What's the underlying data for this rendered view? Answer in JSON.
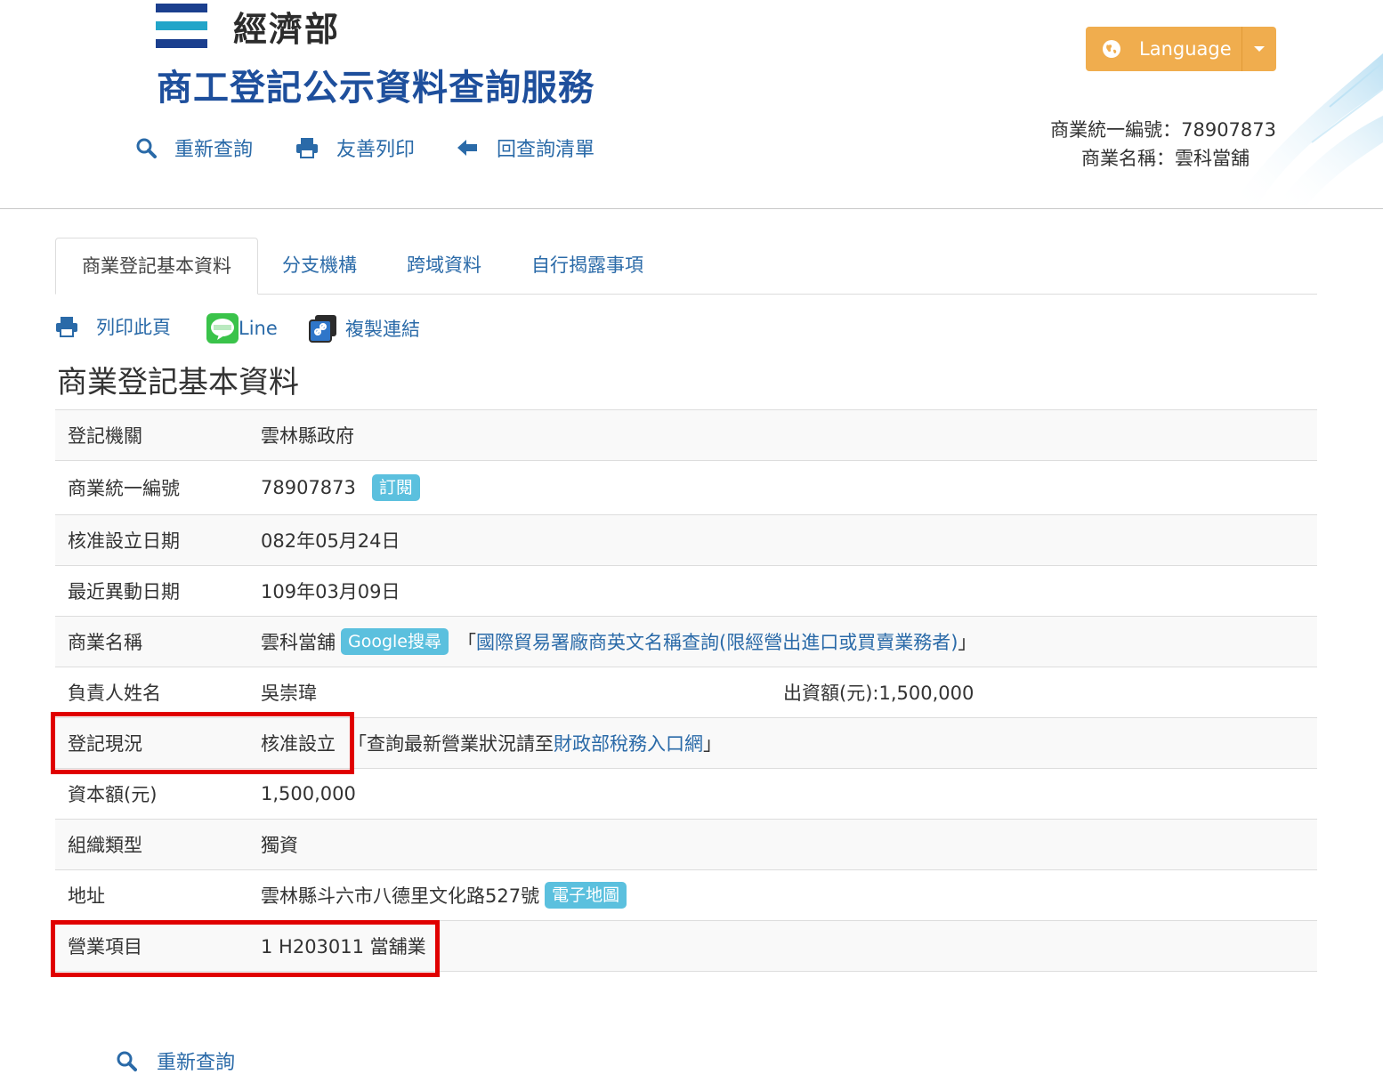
{
  "header": {
    "ministry": "經濟部",
    "service_title": "商工登記公示資料查詢服務",
    "language_button": "Language",
    "links": {
      "requery": "重新查詢",
      "print_friendly": "友善列印",
      "back_to_list": "回查詢清單"
    },
    "biz_id_line": "商業統一編號：78907873",
    "biz_name_line": "商業名稱：雲科當舖"
  },
  "tabs": [
    "商業登記基本資料",
    "分支機構",
    "跨域資料",
    "自行揭露事項"
  ],
  "actions": {
    "print_page": "列印此頁",
    "line": "Line",
    "copy_link": "複製連結"
  },
  "section_title": "商業登記基本資料",
  "rows": {
    "registry": {
      "label": "登記機關",
      "value": "雲林縣政府"
    },
    "biz_id": {
      "label": "商業統一編號",
      "value": "78907873",
      "badge": "訂閱"
    },
    "approved_date": {
      "label": "核准設立日期",
      "value": "082年05月24日"
    },
    "changed_date": {
      "label": "最近異動日期",
      "value": "109年03月09日"
    },
    "biz_name": {
      "label": "商業名稱",
      "value": "雲科當舖",
      "badge": "Google搜尋",
      "link_open": "「",
      "link": "國際貿易署廠商英文名稱查詢(限經營出進口或買賣業務者)",
      "link_close": "」"
    },
    "owner": {
      "label": "負責人姓名",
      "value": "吳崇瑋",
      "capital_contribution": "出資額(元):1,500,000"
    },
    "status": {
      "label": "登記現況",
      "value": "核准設立",
      "note_open": "「查詢最新營業狀況請至 ",
      "note_link": "財政部稅務入口網",
      "note_close": " 」"
    },
    "capital": {
      "label": "資本額(元)",
      "value": "1,500,000"
    },
    "org_type": {
      "label": "組織類型",
      "value": "獨資"
    },
    "address": {
      "label": "地址",
      "value": "雲林縣斗六市八德里文化路527號",
      "badge": "電子地圖"
    },
    "business_items": {
      "label": "營業項目",
      "value": "1 H203011 當舖業"
    }
  },
  "footer": {
    "requery": "重新查詢"
  },
  "colors": {
    "link": "#2a6aa8",
    "language_button": "#f0ad4e",
    "badge": "#5bc0de",
    "highlight": "#e00000",
    "title": "#1e4f9c"
  }
}
